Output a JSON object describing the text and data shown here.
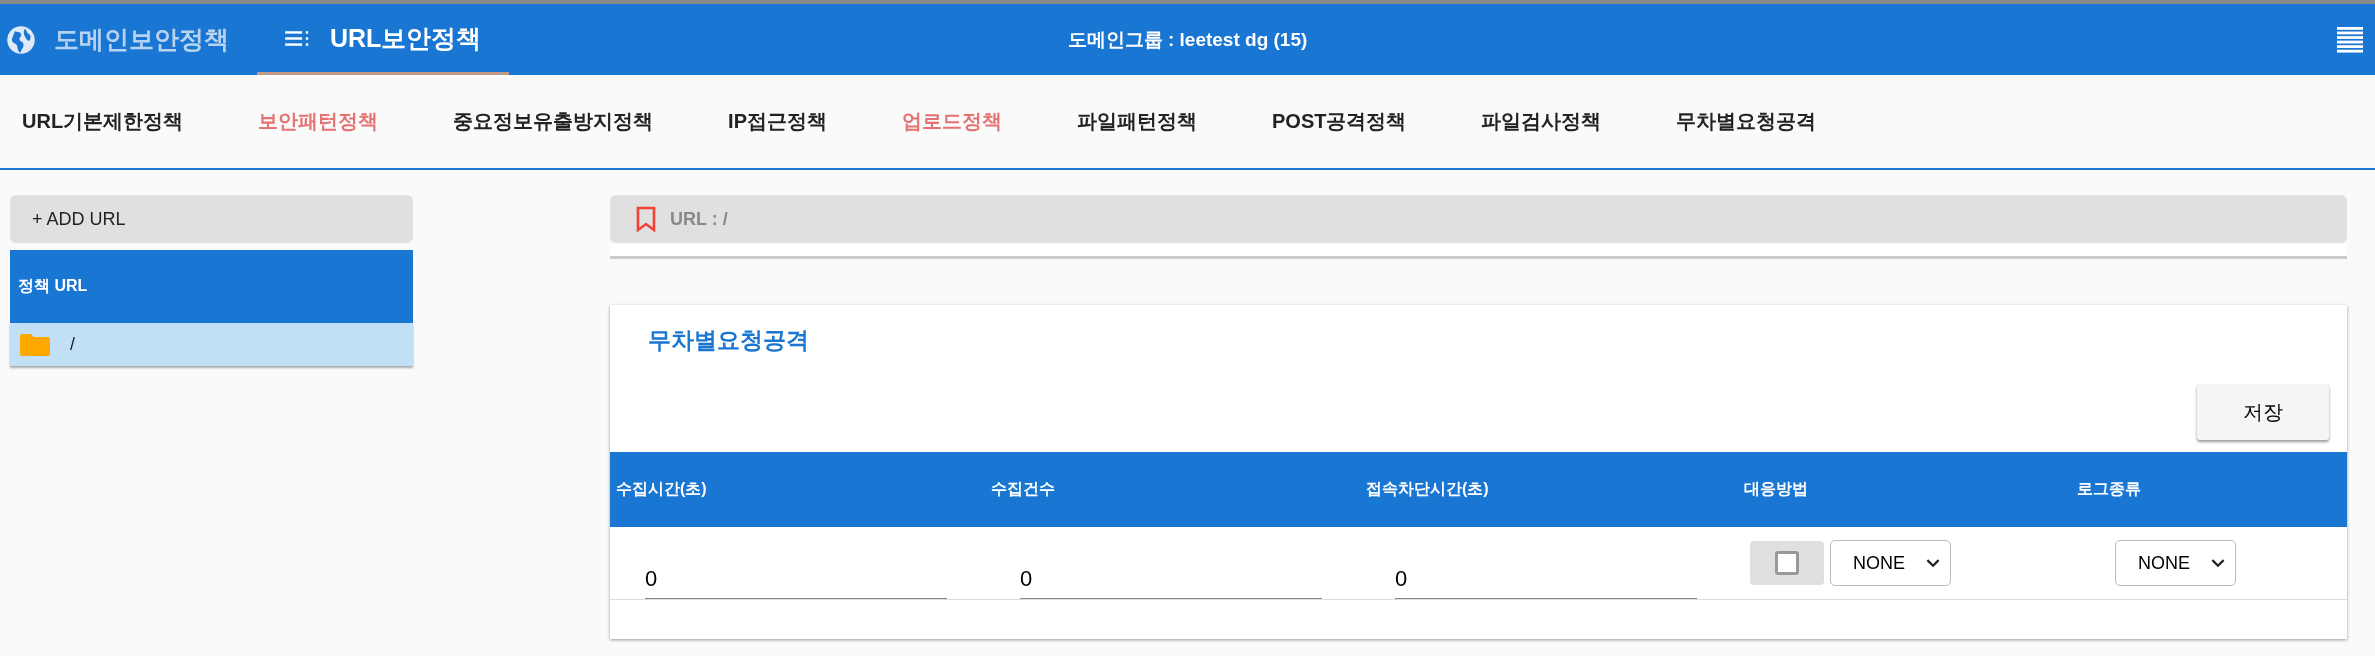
{
  "header": {
    "domain_menu": "도메인보안정책",
    "url_menu": "URL보안정책",
    "group_label": "도메인그룹 : leetest dg (15)"
  },
  "tabs": [
    {
      "label": "URL기본제한정책",
      "highlighted": false
    },
    {
      "label": "보안패턴정책",
      "highlighted": true
    },
    {
      "label": "중요정보유출방지정책",
      "highlighted": false
    },
    {
      "label": "IP접근정책",
      "highlighted": false
    },
    {
      "label": "업로드정책",
      "highlighted": true
    },
    {
      "label": "파일패턴정책",
      "highlighted": false
    },
    {
      "label": "POST공격정책",
      "highlighted": false
    },
    {
      "label": "파일검사정책",
      "highlighted": false
    },
    {
      "label": "무차별요청공격",
      "highlighted": false
    }
  ],
  "sidebar": {
    "add_button": "+ ADD URL",
    "column": "정책 URL",
    "items": [
      {
        "label": "/",
        "selected": true
      }
    ]
  },
  "url_bar": {
    "label": "URL : /"
  },
  "panel": {
    "title": "무차별요청공격",
    "save_button": "저장",
    "columns": [
      "수집시간(초)",
      "수집건수",
      "접속차단시간(초)",
      "대응방법",
      "로그종류"
    ],
    "row": {
      "collect_time": "0",
      "collect_count": "0",
      "block_time": "0",
      "action_checked": false,
      "action": "NONE",
      "log_type": "NONE"
    }
  }
}
